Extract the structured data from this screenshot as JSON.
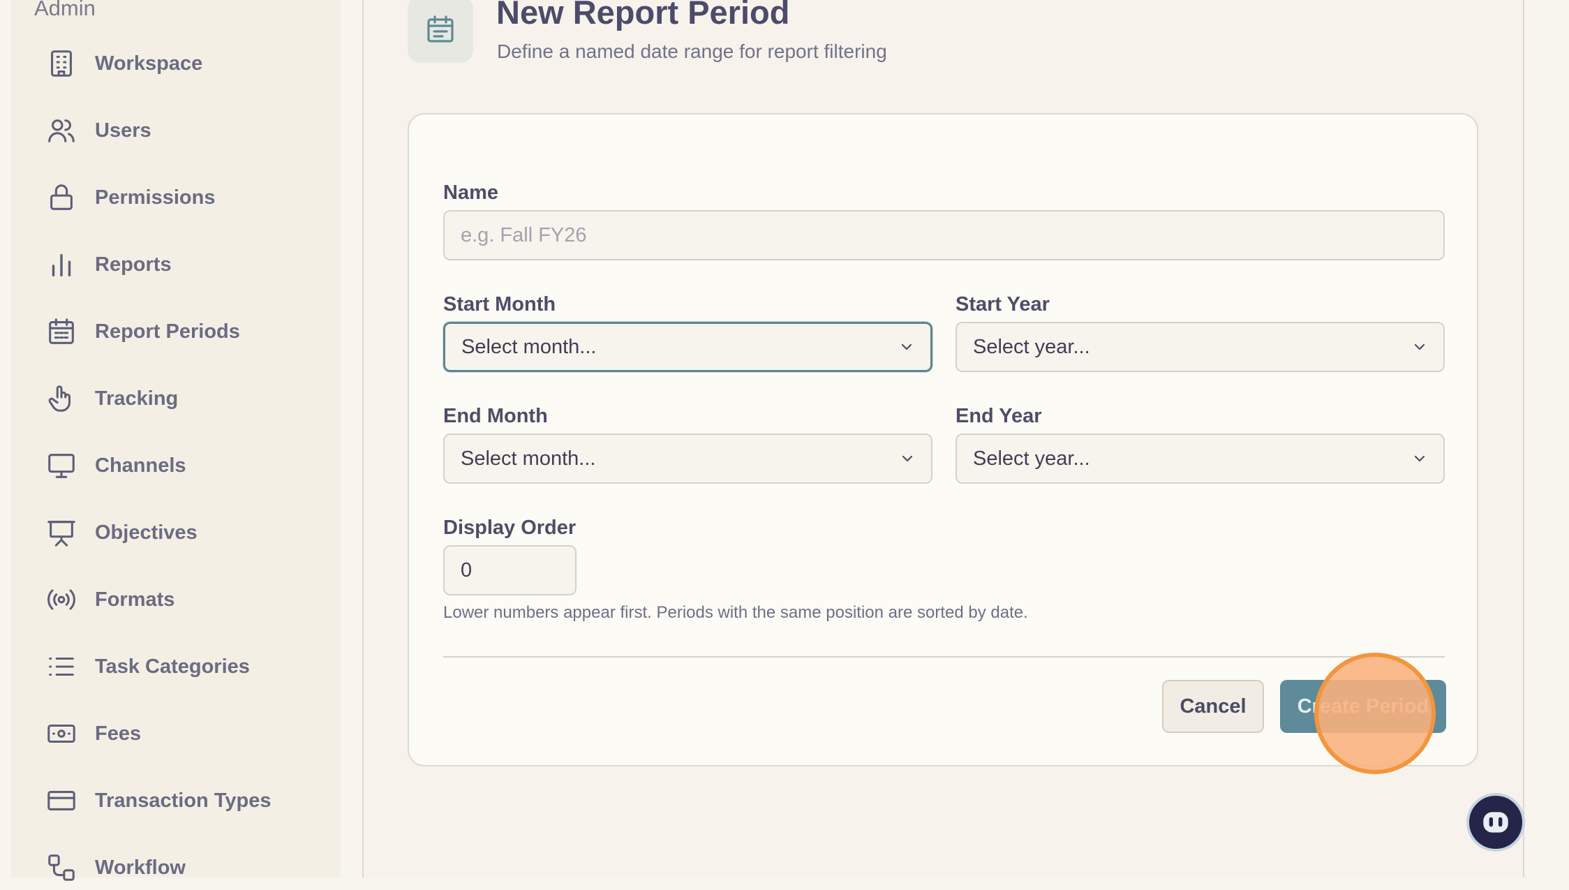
{
  "sidebar": {
    "heading": "Admin",
    "items": [
      {
        "label": "Workspace",
        "icon": "building-icon"
      },
      {
        "label": "Users",
        "icon": "users-icon"
      },
      {
        "label": "Permissions",
        "icon": "lock-icon"
      },
      {
        "label": "Reports",
        "icon": "bar-chart-icon"
      },
      {
        "label": "Report Periods",
        "icon": "calendar-icon"
      },
      {
        "label": "Tracking",
        "icon": "pointer-hand-icon"
      },
      {
        "label": "Channels",
        "icon": "monitor-icon"
      },
      {
        "label": "Objectives",
        "icon": "presentation-icon"
      },
      {
        "label": "Formats",
        "icon": "broadcast-icon"
      },
      {
        "label": "Task Categories",
        "icon": "list-icon"
      },
      {
        "label": "Fees",
        "icon": "banknote-icon"
      },
      {
        "label": "Transaction Types",
        "icon": "credit-card-icon"
      },
      {
        "label": "Workflow",
        "icon": "workflow-icon"
      }
    ]
  },
  "header": {
    "icon": "calendar-icon",
    "title": "New Report Period",
    "subtitle": "Define a named date range for report filtering"
  },
  "form": {
    "name": {
      "label": "Name",
      "placeholder": "e.g. Fall FY26",
      "value": ""
    },
    "start_month": {
      "label": "Start Month",
      "value": "Select month..."
    },
    "start_year": {
      "label": "Start Year",
      "value": "Select year..."
    },
    "end_month": {
      "label": "End Month",
      "value": "Select month..."
    },
    "end_year": {
      "label": "End Year",
      "value": "Select year..."
    },
    "display_order": {
      "label": "Display Order",
      "value": "0",
      "help": "Lower numbers appear first. Periods with the same position are sorted by date."
    },
    "cancel_label": "Cancel",
    "submit_label": "Create Period"
  },
  "assistant": {
    "icon": "robot-icon"
  },
  "colors": {
    "accent": "#5e8a99",
    "focus_border": "#5d8691",
    "click_highlight": "#f3953d",
    "sidebar_bg": "#f4efe5",
    "card_bg": "#fdfbf6"
  }
}
